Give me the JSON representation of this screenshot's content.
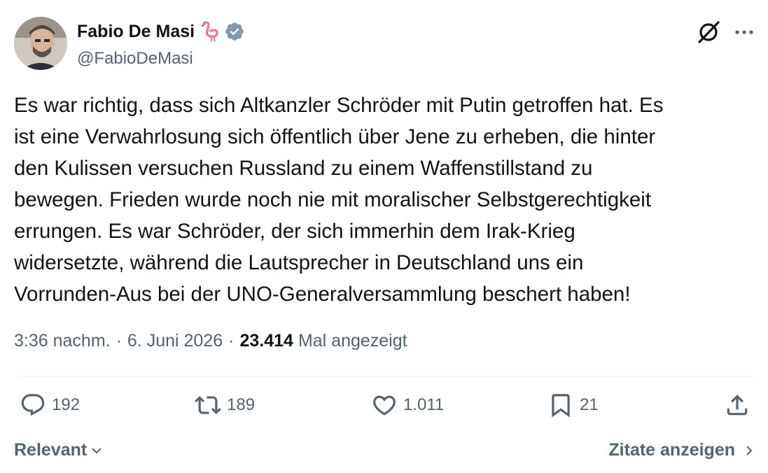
{
  "author": {
    "display_name": "Fabio De Masi",
    "handle": "@FabioDeMasi",
    "name_emoji": "flamingo-icon",
    "verified": "verified-badge-icon"
  },
  "tweet": {
    "text": "Es war richtig, dass sich Altkanzler Schröder mit Putin getroffen hat. Es\nist eine Verwahrlosung sich öffentlich über Jene zu erheben, die hinter\nden Kulissen versuchen Russland zu einem Waffenstillstand zu\nbewegen. Frieden wurde noch nie mit moralischer Selbstgerechtigkeit\nerrungen. Es war Schröder, der sich immerhin dem Irak-Krieg\nwidersetzte, während die Lautsprecher in Deutschland uns ein\nVorrunden-Aus bei der UNO-Generalversammlung beschert haben!",
    "time": "3:36 nachm.",
    "separator": "·",
    "date": "6. Juni 2026",
    "views_count": "23.414",
    "views_label": "Mal angezeigt"
  },
  "actions": {
    "replies": "192",
    "retweets": "189",
    "likes": "1.011",
    "bookmarks": "21"
  },
  "footer": {
    "sort_label": "Relevant",
    "quotes_label": "Zitate anzeigen"
  },
  "colors": {
    "text_primary": "#0f1419",
    "text_secondary": "#536471",
    "verified_badge": "#829aab",
    "divider": "#eff3f4"
  }
}
